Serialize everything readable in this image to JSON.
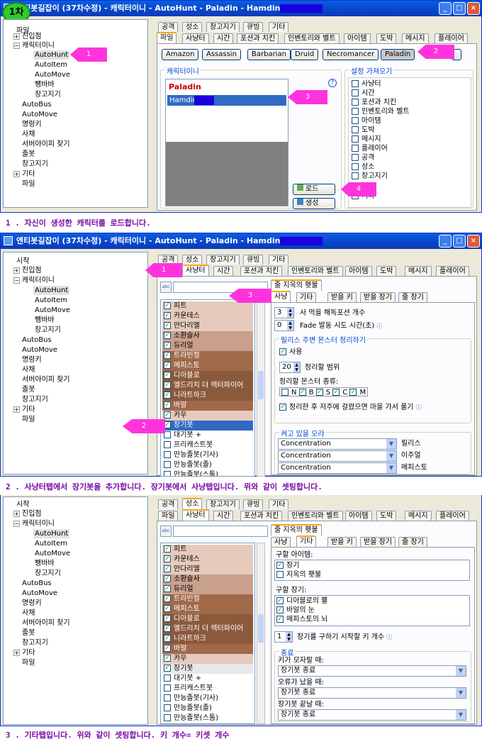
{
  "badge": "1차",
  "windows": [
    {
      "title": "엔티봇길잡이 (37차수정) - 캐릭터이니 - AutoHunt - Paladin - Hamdin"
    },
    {
      "title": "엔티봇길잡이 (37차수정) - 캐릭터이니 - AutoHunt - Paladin - Hamdin"
    },
    {
      "title": ""
    }
  ],
  "tree": [
    "시작",
    "진입점",
    "캐릭터이니",
    "AutoHunt",
    "AutoItem",
    "AutoMove",
    "뺑바바",
    "창고지기",
    "AutoBus",
    "AutoMove",
    "명령키",
    "사채",
    "서버아이피 찾기",
    "졸봇",
    "창고지기",
    "기타",
    "파일"
  ],
  "tree_label_top": "파일",
  "tabs_row1": [
    "공격",
    "성소",
    "창고지기",
    "큐빙",
    "기타"
  ],
  "tabs_row2": [
    "파일",
    "사냥터",
    "시간",
    "포션과 치킨",
    "인벤토리와 벨트",
    "아이템",
    "도박",
    "메시지",
    "플레이어"
  ],
  "classes": [
    "Amazon",
    "Assassin",
    "Barbarian",
    "Druid",
    "Necromancer",
    "Paladin"
  ],
  "char_group": "캐릭터이니",
  "char_header": "Paladin",
  "char_name": "Hamdin",
  "help_mark": "?",
  "load_btn": "로드",
  "create_btn": "생성",
  "import_group": "설정 가져오기",
  "import_items": [
    "사냥터",
    "시간",
    "포션과 치킨",
    "인벤토리와 벨트",
    "아이템",
    "도박",
    "메시지",
    "플레이어",
    "공격",
    "성소",
    "창고지기",
    "기타"
  ],
  "arrows": [
    "1",
    "2",
    "3",
    "4",
    "1",
    "2",
    "3"
  ],
  "captions": [
    "1 . 자신이 생성한 캐릭터를 로드합니다.",
    "2 . 사냥터탭에서 장기봇을 추가합니다. 장기봇에서 사냥탭입니다. 위와 같이 셋팅합니다.",
    "3 . 기타탭입니다. 위와 같이 셋팅합니다. 키 개수= 키셋 개수"
  ],
  "hunt_list": [
    "피트",
    "카운테스",
    "안다리엘",
    "소환술사",
    "듀리얼",
    "트라빈컬",
    "메피스토",
    "디아블로",
    "엘드리치 더 렉터파이어",
    "니라트하크",
    "바알",
    "카우",
    "장기봇",
    "대기봇 +",
    "프리캐스트봇",
    "만능졸봇(기사)",
    "만능졸봇(졸)",
    "만능졸봇(스톰)"
  ],
  "sub_header": "줄 지옥의 횃불",
  "sub_tabs": [
    "사냥",
    "기타",
    "받을 키",
    "받을 장기",
    "줄 장기"
  ],
  "s2": {
    "potion_count": "3",
    "potion_label": "사 먹을 해독포션 개수",
    "fade_value": "0",
    "fade_label": "Fade 발동 시도 시간(초)",
    "release_group": "릴리스 주변 몬스터 정리하기",
    "use_label": "사용",
    "range_value": "20",
    "range_label": "정리할 범위",
    "types_label": "정리할 몬스터 종류:",
    "types": [
      "N",
      "B",
      "S",
      "C",
      "M"
    ],
    "curse_label": "정리한 후 저주에 걸렸으면 마을 가서 풀기",
    "aura_group": "켜고 있을 오라",
    "auras": [
      {
        "value": "Concentration",
        "label": "릴리스"
      },
      {
        "value": "Concentration",
        "label": "이주얼"
      },
      {
        "value": "Concentration",
        "label": "메피스토"
      }
    ]
  },
  "s3": {
    "items_label": "구할 아이템:",
    "items": [
      "장기",
      "지옥의 횃불"
    ],
    "organs_label": "구할 장기:",
    "organs": [
      "디아블로의 뿔",
      "바알의 눈",
      "메피스토의 뇌"
    ],
    "key_count": "1",
    "key_label": "장기를 구하기 시작할 키 개수",
    "end_group": "종료",
    "end_rows": [
      {
        "label": "키가 모자랄 때:",
        "value": "장기봇 종료"
      },
      {
        "label": "오류가 났을 때:",
        "value": "장기봇 종료"
      },
      {
        "label": "장기봇 끝날 때:",
        "value": "장기봇 종료"
      }
    ]
  }
}
